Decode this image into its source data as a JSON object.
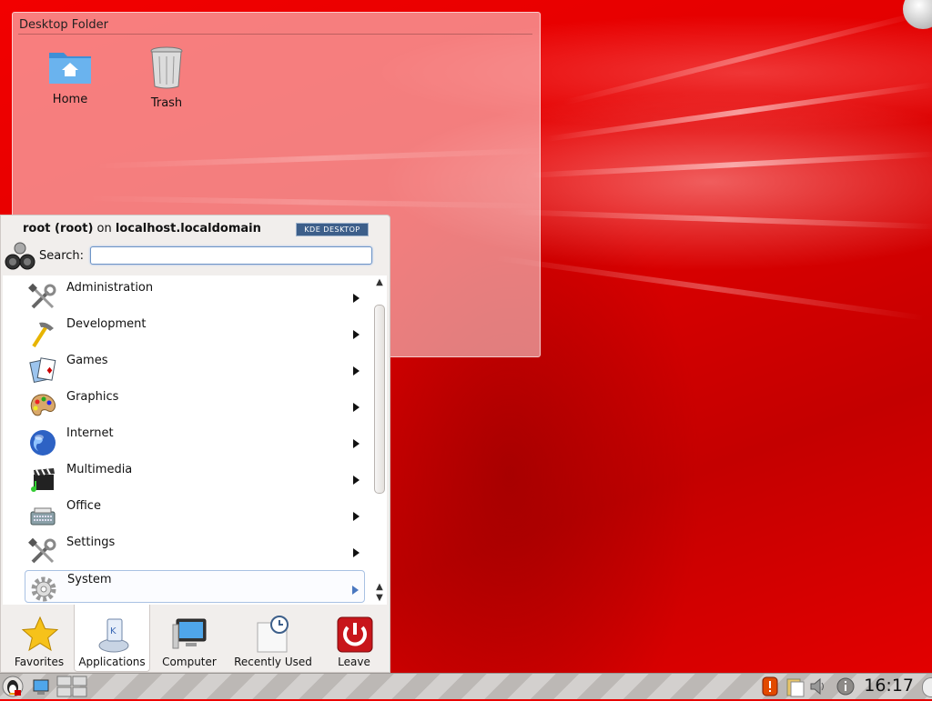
{
  "desktop": {
    "folder_title": "Desktop Folder",
    "icons": [
      {
        "label": "Home",
        "icon": "home-folder-icon"
      },
      {
        "label": "Trash",
        "icon": "trash-icon"
      }
    ]
  },
  "menu": {
    "user_name": "root (root)",
    "on_text": "on",
    "host": "localhost.localdomain",
    "badge": "KDE DESKTOP",
    "search_label": "Search:",
    "search_value": "",
    "categories": [
      {
        "label": "Administration",
        "icon": "tools-icon"
      },
      {
        "label": "Development",
        "icon": "hammer-icon"
      },
      {
        "label": "Games",
        "icon": "cards-icon"
      },
      {
        "label": "Graphics",
        "icon": "palette-icon"
      },
      {
        "label": "Internet",
        "icon": "globe-icon"
      },
      {
        "label": "Multimedia",
        "icon": "clapperboard-icon"
      },
      {
        "label": "Office",
        "icon": "typewriter-icon"
      },
      {
        "label": "Settings",
        "icon": "tools-icon"
      },
      {
        "label": "System",
        "icon": "gear-icon"
      }
    ],
    "tabs": [
      {
        "label": "Favorites",
        "icon": "star-icon"
      },
      {
        "label": "Applications",
        "icon": "applications-icon"
      },
      {
        "label": "Computer",
        "icon": "computer-icon"
      },
      {
        "label": "Recently Used",
        "icon": "clock-document-icon"
      },
      {
        "label": "Leave",
        "icon": "power-icon"
      }
    ],
    "active_tab": "Applications"
  },
  "taskbar": {
    "clock": "16:17"
  },
  "colors": {
    "wallpaper": "#e00000",
    "accent": "#4a78c0"
  }
}
